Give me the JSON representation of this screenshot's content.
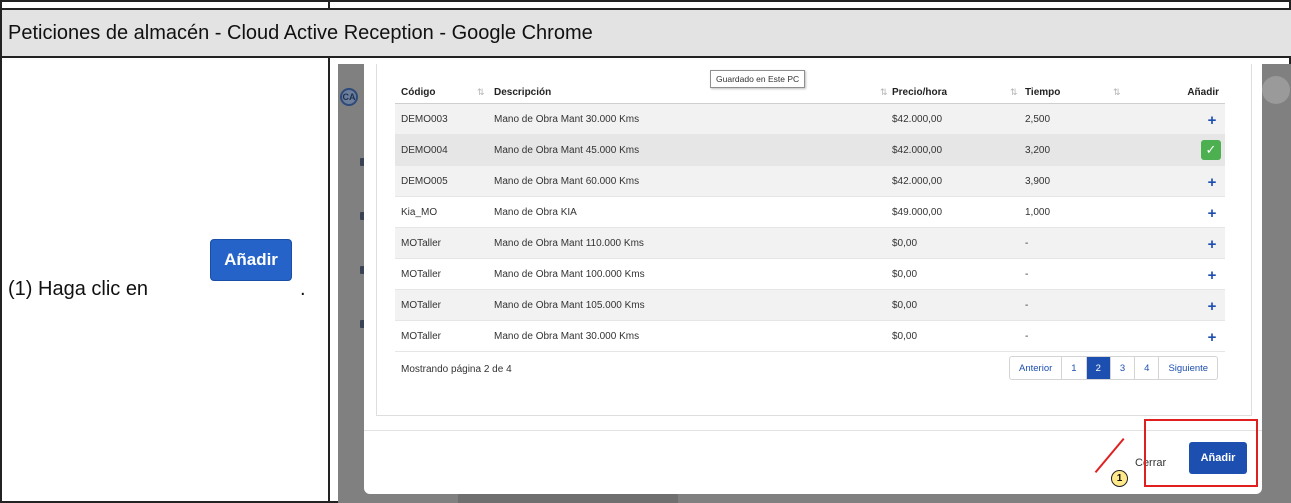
{
  "title_bar": {
    "text": "Peticiones de almacén - Cloud Active Reception - Google Chrome"
  },
  "instruction": {
    "prefix": "(1) Haga clic en",
    "button_label": "Añadir",
    "suffix": "."
  },
  "tooltip": "Guardado en Este PC",
  "table": {
    "headers": {
      "code": "Código",
      "description": "Descripción",
      "price": "Precio/hora",
      "time": "Tiempo",
      "add": "Añadir"
    },
    "rows": [
      {
        "code": "DEMO003",
        "description": "Mano de Obra Mant 30.000 Kms",
        "price": "$42.000,00",
        "time": "2,500",
        "state": "add"
      },
      {
        "code": "DEMO004",
        "description": "Mano de Obra Mant 45.000 Kms",
        "price": "$42.000,00",
        "time": "3,200",
        "state": "added"
      },
      {
        "code": "DEMO005",
        "description": "Mano de Obra Mant 60.000 Kms",
        "price": "$42.000,00",
        "time": "3,900",
        "state": "add"
      },
      {
        "code": "Kia_MO",
        "description": "Mano de Obra KIA",
        "price": "$49.000,00",
        "time": "1,000",
        "state": "add"
      },
      {
        "code": "MOTaller",
        "description": "Mano de Obra Mant 110.000 Kms",
        "price": "$0,00",
        "time": "-",
        "state": "add"
      },
      {
        "code": "MOTaller",
        "description": "Mano de Obra Mant 100.000 Kms",
        "price": "$0,00",
        "time": "-",
        "state": "add"
      },
      {
        "code": "MOTaller",
        "description": "Mano de Obra Mant 105.000 Kms",
        "price": "$0,00",
        "time": "-",
        "state": "add"
      },
      {
        "code": "MOTaller",
        "description": "Mano de Obra Mant 30.000 Kms",
        "price": "$0,00",
        "time": "-",
        "state": "add"
      }
    ]
  },
  "footer": {
    "status": "Mostrando página 2 de 4"
  },
  "pagination": {
    "prev": "Anterior",
    "pages": [
      "1",
      "2",
      "3",
      "4"
    ],
    "active": "2",
    "next": "Siguiente"
  },
  "modal_actions": {
    "close": "Cerrar",
    "add": "Añadir"
  },
  "callout_number": "1",
  "side_logo": "CA",
  "colors": {
    "primary": "#1d4fb0",
    "success": "#4caf50",
    "highlight": "#e02020"
  }
}
